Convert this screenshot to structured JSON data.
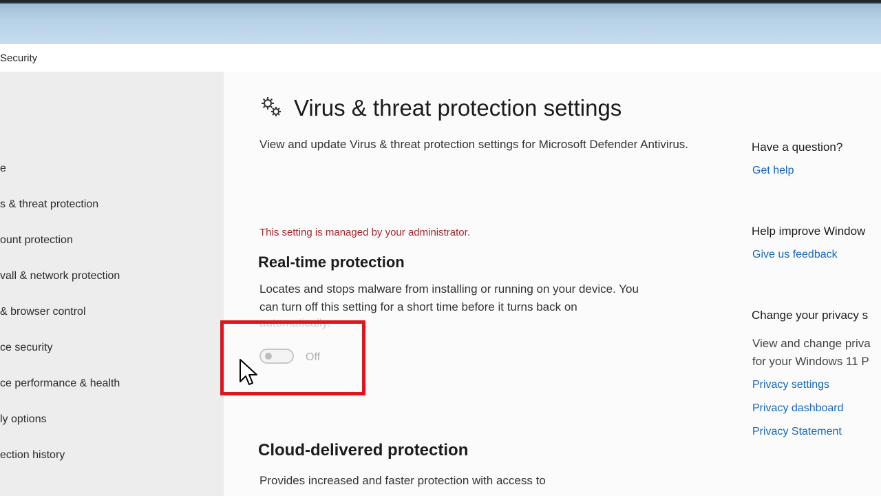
{
  "window": {
    "app_title": "Security"
  },
  "sidebar": {
    "items": [
      {
        "label": "e"
      },
      {
        "label": "s & threat protection"
      },
      {
        "label": "ount protection"
      },
      {
        "label": "vall & network protection"
      },
      {
        "label": "& browser control"
      },
      {
        "label": "ce security"
      },
      {
        "label": "ce performance & health"
      },
      {
        "label": "ly options"
      },
      {
        "label": "ection history"
      }
    ]
  },
  "main": {
    "title": "Virus & threat protection settings",
    "description": "View and update Virus & threat protection settings for Microsoft Defender Antivirus.",
    "admin_note": "This setting is managed by your administrator.",
    "realtime": {
      "title": "Real-time protection",
      "description_line1": "Locates and stops malware from installing or running on your device. You",
      "description_line2": "can turn off this setting for a short time before it turns back on",
      "description_line3": "automatically.",
      "toggle_state": "Off"
    },
    "cloud": {
      "title": "Cloud-delivered protection",
      "description": "Provides increased and faster protection with access to"
    }
  },
  "right_panel": {
    "question": {
      "heading": "Have a question?",
      "link": "Get help"
    },
    "improve": {
      "heading": "Help improve Window",
      "link": "Give us feedback"
    },
    "privacy": {
      "heading": "Change your privacy s",
      "text_line1": "View and change priva",
      "text_line2": "for your Windows 11 P",
      "links": [
        "Privacy settings",
        "Privacy dashboard",
        "Privacy Statement"
      ]
    }
  },
  "colors": {
    "highlight": "#e0141c",
    "link": "#1667b6",
    "admin_note": "#a4262c",
    "sidebar_bg": "#ededed"
  }
}
